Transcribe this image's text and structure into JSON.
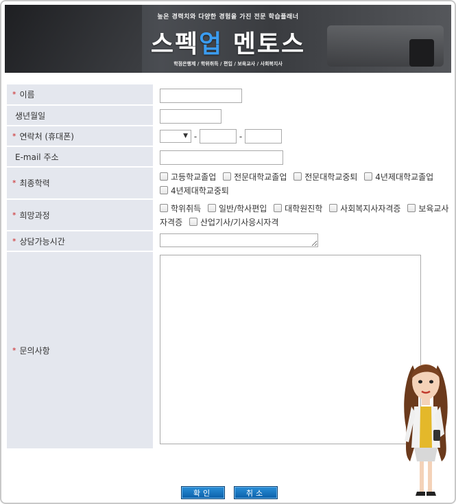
{
  "banner": {
    "subtitle": "높은 경력치와 다양한 경험을 가진 전문 학습플래너",
    "title_a": "스펙",
    "title_b": "업",
    "title_c": " 멘토스",
    "tags": "학점은행제 / 학위취득 / 편입 / 보육교사 / 사회복지사"
  },
  "form": {
    "name": {
      "label": "이름",
      "required": true,
      "value": ""
    },
    "birth": {
      "label": "생년월일",
      "required": false,
      "value": ""
    },
    "phone": {
      "label": "연락처 (휴대폰)",
      "required": true,
      "prefix": "",
      "mid": "",
      "last": ""
    },
    "email": {
      "label": "E-mail 주소",
      "required": false,
      "value": ""
    },
    "education": {
      "label": "최종학력",
      "required": true,
      "options": [
        "고등학교졸업",
        "전문대학교졸업",
        "전문대학교중퇴",
        "4년제대학교졸업",
        "4년제대학교중퇴"
      ]
    },
    "course": {
      "label": "희망과정",
      "required": true,
      "options": [
        "학위취득",
        "일반/학사편입",
        "대학원진학",
        "사회복지사자격증",
        "보육교사자격증",
        "산업기사/기사응시자격"
      ]
    },
    "time": {
      "label": "상담가능시간",
      "required": true,
      "value": ""
    },
    "inquiry": {
      "label": "문의사항",
      "required": true,
      "value": ""
    }
  },
  "buttons": {
    "confirm": "확인",
    "cancel": "취소"
  },
  "colors": {
    "label_bg": "#e4e7ee",
    "required": "#cc2222",
    "button": "#1a75c2"
  }
}
